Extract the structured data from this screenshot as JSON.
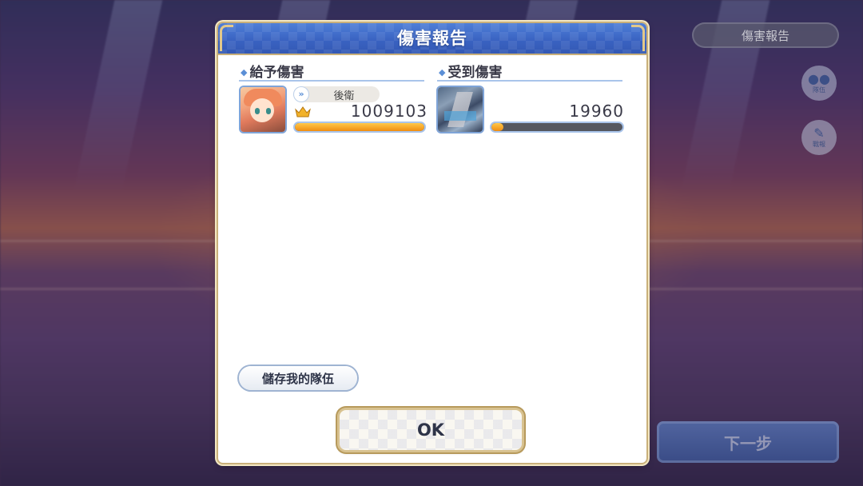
{
  "header": {
    "title": "傷害報告"
  },
  "hud": {
    "damage_report_label": "傷害報告",
    "party_button_label": "隊伍",
    "log_button_label": "戰報",
    "next_button_label": "下一步",
    "party_icon": "party-icon",
    "log_icon": "edit-icon"
  },
  "dealt": {
    "title": "給予傷害",
    "entries": [
      {
        "position_label": "後衛",
        "position_icon": "rear-position-icon",
        "rank_icon": "crown-icon",
        "damage": "1009103",
        "bar_fraction": 1.0
      }
    ]
  },
  "received": {
    "title": "受到傷害",
    "entries": [
      {
        "damage": "19960",
        "bar_fraction": 0.09
      }
    ]
  },
  "buttons": {
    "save_team_label": "儲存我的隊伍",
    "ok_label": "OK"
  },
  "colors": {
    "header_blue": "#3a63c2",
    "bar_fill": "#f08d12",
    "bar_track": "#55575f",
    "accent_gold": "#c9b07a"
  }
}
